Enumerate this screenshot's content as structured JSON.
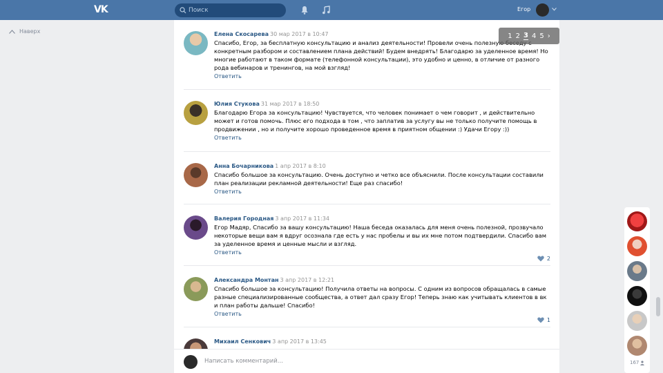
{
  "topbar": {
    "logo": "VK",
    "search_placeholder": "Поиск",
    "user_name": "Егор"
  },
  "back_link": "Наверх",
  "pager": {
    "pages": [
      "1",
      "2",
      "3",
      "4",
      "5"
    ],
    "current": "3",
    "next": "›"
  },
  "comments": [
    {
      "author": "Елена Скосарева",
      "date": "30 мар 2017 в 10:47",
      "text": "Спасибо, Егор, за бесплатную консультацию и анализ деятельности! Провели очень полезную беседу с конкретным разбором и составлением плана действий! Будем внедрять! Благодарю за уделенное время! Но многие работают в таком формате (телефонной консультации), это удобно и ценно, в отличие от разного рода вебинаров и тренингов, на мой взгляд!",
      "reply": "Ответить",
      "likes": ""
    },
    {
      "author": "Юлия Стукова",
      "date": "31 мар 2017 в 18:50",
      "text": "Благодарю Егора за консультацию! Чувствуется, что человек понимает о чем говорит , и действительно может и готов помочь. Плюс его подхода в том , что заплатив за услугу вы не только получите помощь в продвижении , но и получите хорошо проведенное время в приятном общении :) Удачи Егору :))",
      "reply": "Ответить",
      "likes": ""
    },
    {
      "author": "Анна Бочарникова",
      "date": "1 апр 2017 в 8:10",
      "text": "Спасибо большое за консультацию. Очень доступно и четко все объяснили. После консультации составили план реализации рекламной деятельности! Еще раз спасибо!",
      "reply": "Ответить",
      "likes": ""
    },
    {
      "author": "Валерия Городная",
      "date": "3 апр 2017 в 11:34",
      "text": "Егор Мадяр, Спасибо за вашу консультацию! Наша беседа оказалась для меня очень полезной, прозвучало некоторые вещи вам я вдруг осознала где есть у нас пробелы и вы их мне потом подтвердили. Спасибо вам за уделенное время и ценные мысли и взгляд.",
      "reply": "Ответить",
      "likes": "2"
    },
    {
      "author": "Александра Монтан",
      "date": "3 апр 2017 в 12:21",
      "text": "Спасибо большое за консультацию! Получила ответы на вопросы. С одним из вопросов обращалась в самые разные специализированные сообщества, а ответ дал сразу Егор! Теперь знаю как учитывать клиентов в вк и план работы дальше! Спасибо!",
      "reply": "Ответить",
      "likes": "1"
    },
    {
      "author": "Михаил Сенкович",
      "date": "3 апр 2017 в 13:45",
      "text": "",
      "reply": "",
      "likes": ""
    }
  ],
  "reply_placeholder": "Написать комментарий...",
  "likers_count": "167",
  "colors": {
    "brand": "#4a76a8",
    "link": "#2a5885",
    "background": "#edeef0"
  }
}
